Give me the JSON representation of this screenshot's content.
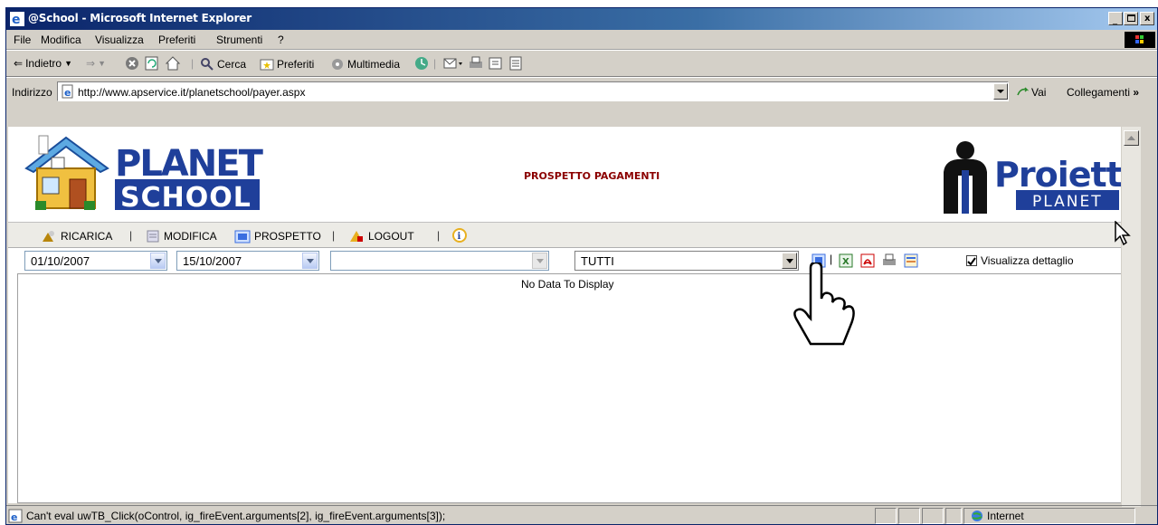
{
  "window": {
    "title": "@School - Microsoft Internet Explorer"
  },
  "menubar": {
    "items": [
      "File",
      "Modifica",
      "Visualizza",
      "Preferiti",
      "Strumenti",
      "?"
    ]
  },
  "toolbar": {
    "back": "Indietro",
    "search": "Cerca",
    "favorites": "Preferiti",
    "media": "Multimedia"
  },
  "address": {
    "label": "Indirizzo",
    "url": "http://www.apservice.it/planetschool/payer.aspx",
    "go": "Vai",
    "links": "Collegamenti"
  },
  "page": {
    "logo_left_line1": "PLANET",
    "logo_left_line2": "SCHOOL",
    "title": "PROSPETTO PAGAMENTI",
    "logo_right_line1": "Proietti",
    "logo_right_line2": "PLANET",
    "nav": {
      "ricarica": "RICARICA",
      "modifica": "MODIFICA",
      "prospetto": "PROSPETTO",
      "logout": "LOGOUT",
      "sep": "|"
    },
    "filters": {
      "date_from": "01/10/2007",
      "date_to": "15/10/2007",
      "student": "",
      "type": "TUTTI",
      "detail_label": "Visualizza dettaglio",
      "detail_checked": true
    },
    "grid": {
      "empty_text": "No Data To Display"
    }
  },
  "statusbar": {
    "text": "Can't eval uwTB_Click(oControl, ig_fireEvent.arguments[2], ig_fireEvent.arguments[3]);",
    "zone": "Internet"
  },
  "colors": {
    "title_red": "#8b0000",
    "planet_blue": "#1f3f9a",
    "titlebar_blue": "#0a246a"
  }
}
